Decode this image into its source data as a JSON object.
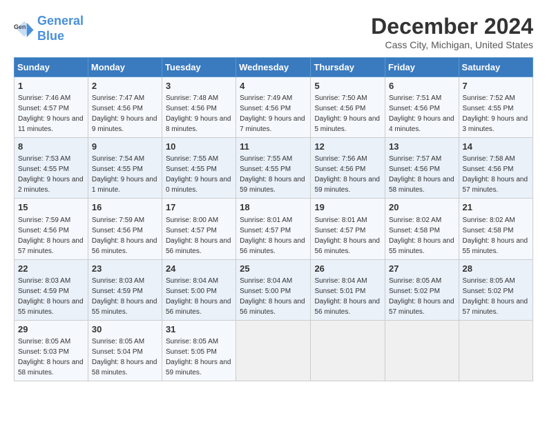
{
  "logo": {
    "line1": "General",
    "line2": "Blue"
  },
  "title": "December 2024",
  "subtitle": "Cass City, Michigan, United States",
  "days_of_week": [
    "Sunday",
    "Monday",
    "Tuesday",
    "Wednesday",
    "Thursday",
    "Friday",
    "Saturday"
  ],
  "weeks": [
    [
      {
        "day": "1",
        "sunrise": "7:46 AM",
        "sunset": "4:57 PM",
        "daylight": "9 hours and 11 minutes."
      },
      {
        "day": "2",
        "sunrise": "7:47 AM",
        "sunset": "4:56 PM",
        "daylight": "9 hours and 9 minutes."
      },
      {
        "day": "3",
        "sunrise": "7:48 AM",
        "sunset": "4:56 PM",
        "daylight": "9 hours and 8 minutes."
      },
      {
        "day": "4",
        "sunrise": "7:49 AM",
        "sunset": "4:56 PM",
        "daylight": "9 hours and 7 minutes."
      },
      {
        "day": "5",
        "sunrise": "7:50 AM",
        "sunset": "4:56 PM",
        "daylight": "9 hours and 5 minutes."
      },
      {
        "day": "6",
        "sunrise": "7:51 AM",
        "sunset": "4:56 PM",
        "daylight": "9 hours and 4 minutes."
      },
      {
        "day": "7",
        "sunrise": "7:52 AM",
        "sunset": "4:55 PM",
        "daylight": "9 hours and 3 minutes."
      }
    ],
    [
      {
        "day": "8",
        "sunrise": "7:53 AM",
        "sunset": "4:55 PM",
        "daylight": "9 hours and 2 minutes."
      },
      {
        "day": "9",
        "sunrise": "7:54 AM",
        "sunset": "4:55 PM",
        "daylight": "9 hours and 1 minute."
      },
      {
        "day": "10",
        "sunrise": "7:55 AM",
        "sunset": "4:55 PM",
        "daylight": "9 hours and 0 minutes."
      },
      {
        "day": "11",
        "sunrise": "7:55 AM",
        "sunset": "4:55 PM",
        "daylight": "8 hours and 59 minutes."
      },
      {
        "day": "12",
        "sunrise": "7:56 AM",
        "sunset": "4:56 PM",
        "daylight": "8 hours and 59 minutes."
      },
      {
        "day": "13",
        "sunrise": "7:57 AM",
        "sunset": "4:56 PM",
        "daylight": "8 hours and 58 minutes."
      },
      {
        "day": "14",
        "sunrise": "7:58 AM",
        "sunset": "4:56 PM",
        "daylight": "8 hours and 57 minutes."
      }
    ],
    [
      {
        "day": "15",
        "sunrise": "7:59 AM",
        "sunset": "4:56 PM",
        "daylight": "8 hours and 57 minutes."
      },
      {
        "day": "16",
        "sunrise": "7:59 AM",
        "sunset": "4:56 PM",
        "daylight": "8 hours and 56 minutes."
      },
      {
        "day": "17",
        "sunrise": "8:00 AM",
        "sunset": "4:57 PM",
        "daylight": "8 hours and 56 minutes."
      },
      {
        "day": "18",
        "sunrise": "8:01 AM",
        "sunset": "4:57 PM",
        "daylight": "8 hours and 56 minutes."
      },
      {
        "day": "19",
        "sunrise": "8:01 AM",
        "sunset": "4:57 PM",
        "daylight": "8 hours and 56 minutes."
      },
      {
        "day": "20",
        "sunrise": "8:02 AM",
        "sunset": "4:58 PM",
        "daylight": "8 hours and 55 minutes."
      },
      {
        "day": "21",
        "sunrise": "8:02 AM",
        "sunset": "4:58 PM",
        "daylight": "8 hours and 55 minutes."
      }
    ],
    [
      {
        "day": "22",
        "sunrise": "8:03 AM",
        "sunset": "4:59 PM",
        "daylight": "8 hours and 55 minutes."
      },
      {
        "day": "23",
        "sunrise": "8:03 AM",
        "sunset": "4:59 PM",
        "daylight": "8 hours and 55 minutes."
      },
      {
        "day": "24",
        "sunrise": "8:04 AM",
        "sunset": "5:00 PM",
        "daylight": "8 hours and 56 minutes."
      },
      {
        "day": "25",
        "sunrise": "8:04 AM",
        "sunset": "5:00 PM",
        "daylight": "8 hours and 56 minutes."
      },
      {
        "day": "26",
        "sunrise": "8:04 AM",
        "sunset": "5:01 PM",
        "daylight": "8 hours and 56 minutes."
      },
      {
        "day": "27",
        "sunrise": "8:05 AM",
        "sunset": "5:02 PM",
        "daylight": "8 hours and 57 minutes."
      },
      {
        "day": "28",
        "sunrise": "8:05 AM",
        "sunset": "5:02 PM",
        "daylight": "8 hours and 57 minutes."
      }
    ],
    [
      {
        "day": "29",
        "sunrise": "8:05 AM",
        "sunset": "5:03 PM",
        "daylight": "8 hours and 58 minutes."
      },
      {
        "day": "30",
        "sunrise": "8:05 AM",
        "sunset": "5:04 PM",
        "daylight": "8 hours and 58 minutes."
      },
      {
        "day": "31",
        "sunrise": "8:05 AM",
        "sunset": "5:05 PM",
        "daylight": "8 hours and 59 minutes."
      },
      null,
      null,
      null,
      null
    ]
  ]
}
